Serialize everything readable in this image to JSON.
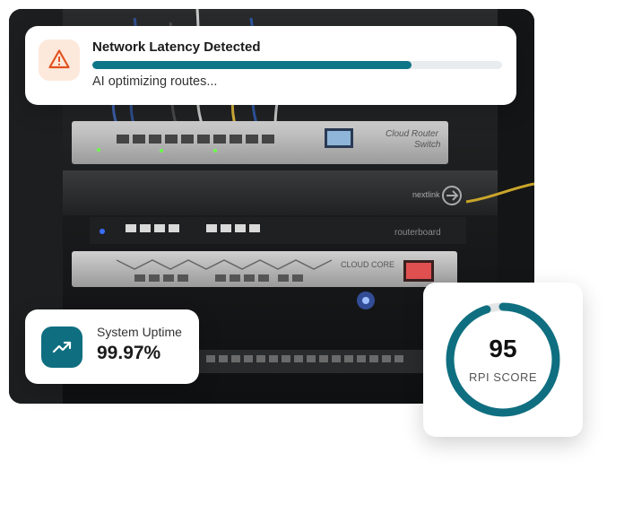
{
  "alert": {
    "title": "Network Latency Detected",
    "subtitle": "AI optimizing routes...",
    "progress_fraction": 0.78,
    "icon": "warning-triangle-icon",
    "accent_color": "#e0521f",
    "bar_color": "#0f7688"
  },
  "uptime": {
    "label": "System Uptime",
    "value": "99.97%",
    "icon": "trending-up-icon",
    "badge_color": "#0f6f80"
  },
  "score": {
    "value": "95",
    "label": "RPI SCORE",
    "fraction": 0.95,
    "ring_color": "#0f6f80",
    "track_color": "#e3e5e6"
  },
  "photo": {
    "subject": "server-rack-photo",
    "device_labels": {
      "switch": "Cloud Router Switch",
      "nextlink": "nextlink",
      "routerboard": "routerboard",
      "core": "CLOUD CORE"
    }
  }
}
